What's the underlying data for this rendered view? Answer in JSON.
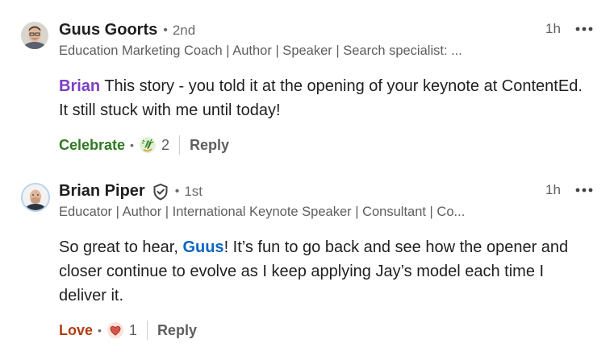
{
  "comments": [
    {
      "author": "Guus Goorts",
      "degree": "2nd",
      "headline": "Education Marketing Coach | Author | Speaker | Search specialist: ...",
      "time": "1h",
      "mention": "Brian",
      "text_after_mention": " This story - you told it at the opening of your keynote at ContentEd. It still stuck with me until today!",
      "reaction_label": "Celebrate",
      "reaction_icon": "celebrate-clap-icon",
      "reaction_count": "2",
      "reply_label": "Reply"
    },
    {
      "author": "Brian Piper",
      "degree": "1st",
      "headline": "Educator | Author | International Keynote Speaker | Consultant | Co...",
      "time": "1h",
      "text_before_mention": "So great to hear, ",
      "mention": "Guus",
      "text_after_mention": "! It’s fun to go back and see how the opener and closer continue to evolve as I keep applying Jay’s model each time I deliver it.",
      "reaction_label": "Love",
      "reaction_icon": "heart-icon",
      "reaction_count": "1",
      "reply_label": "Reply"
    }
  ],
  "colors": {
    "mention_purple": "#7b3fc4",
    "mention_blue": "#0a66c2",
    "celebrate_green": "#2f7a21",
    "love_red": "#b13d16"
  }
}
